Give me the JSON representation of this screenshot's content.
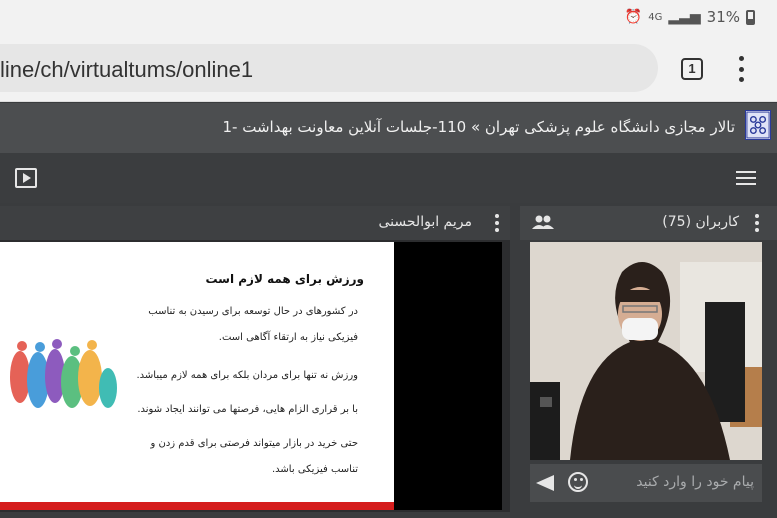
{
  "status_bar": {
    "battery_text": "31%",
    "network_label": "4G"
  },
  "browser": {
    "url_prefix": "line",
    "url_rest": "/ch/virtualtums/online1",
    "tab_count": "1"
  },
  "header": {
    "title": "تالار مجازی دانشگاه علوم پزشکی تهران » 110-جلسات آنلاین معاونت بهداشت -1"
  },
  "presentation": {
    "presenter_name": "مریم ابوالحسنی",
    "slide": {
      "title": "ورزش برای همه لازم است",
      "lines": [
        "در کشورهای در حال توسعه برای رسیدن به تناسب",
        "فیزیکی نیاز به  ارتقاء آگاهی است.",
        "ورزش نه تنها برای مردان بلکه برای همه لازم میباشد.",
        "با بر قراری الزام هایی، فرصتها می توانند ایجاد شوند.",
        "حتی خرید در بازار میتواند فرصتی برای قدم زدن و",
        "تناسب فیزیکی باشد."
      ]
    }
  },
  "users": {
    "title": "کاربران (75)"
  },
  "chat": {
    "placeholder": "پیام خود را وارد کنید"
  },
  "colors": {
    "accent_red": "#d51d1d",
    "panel_dark": "#3a3c3e",
    "title_bar": "#4c4e50"
  },
  "icons": [
    "alarm-icon",
    "signal-icon",
    "battery-icon",
    "tab-count-icon",
    "menu-dots-icon",
    "university-logo-icon",
    "play-icon",
    "hamburger-icon",
    "kebab-icon",
    "users-group-icon",
    "emoji-icon",
    "send-icon"
  ]
}
